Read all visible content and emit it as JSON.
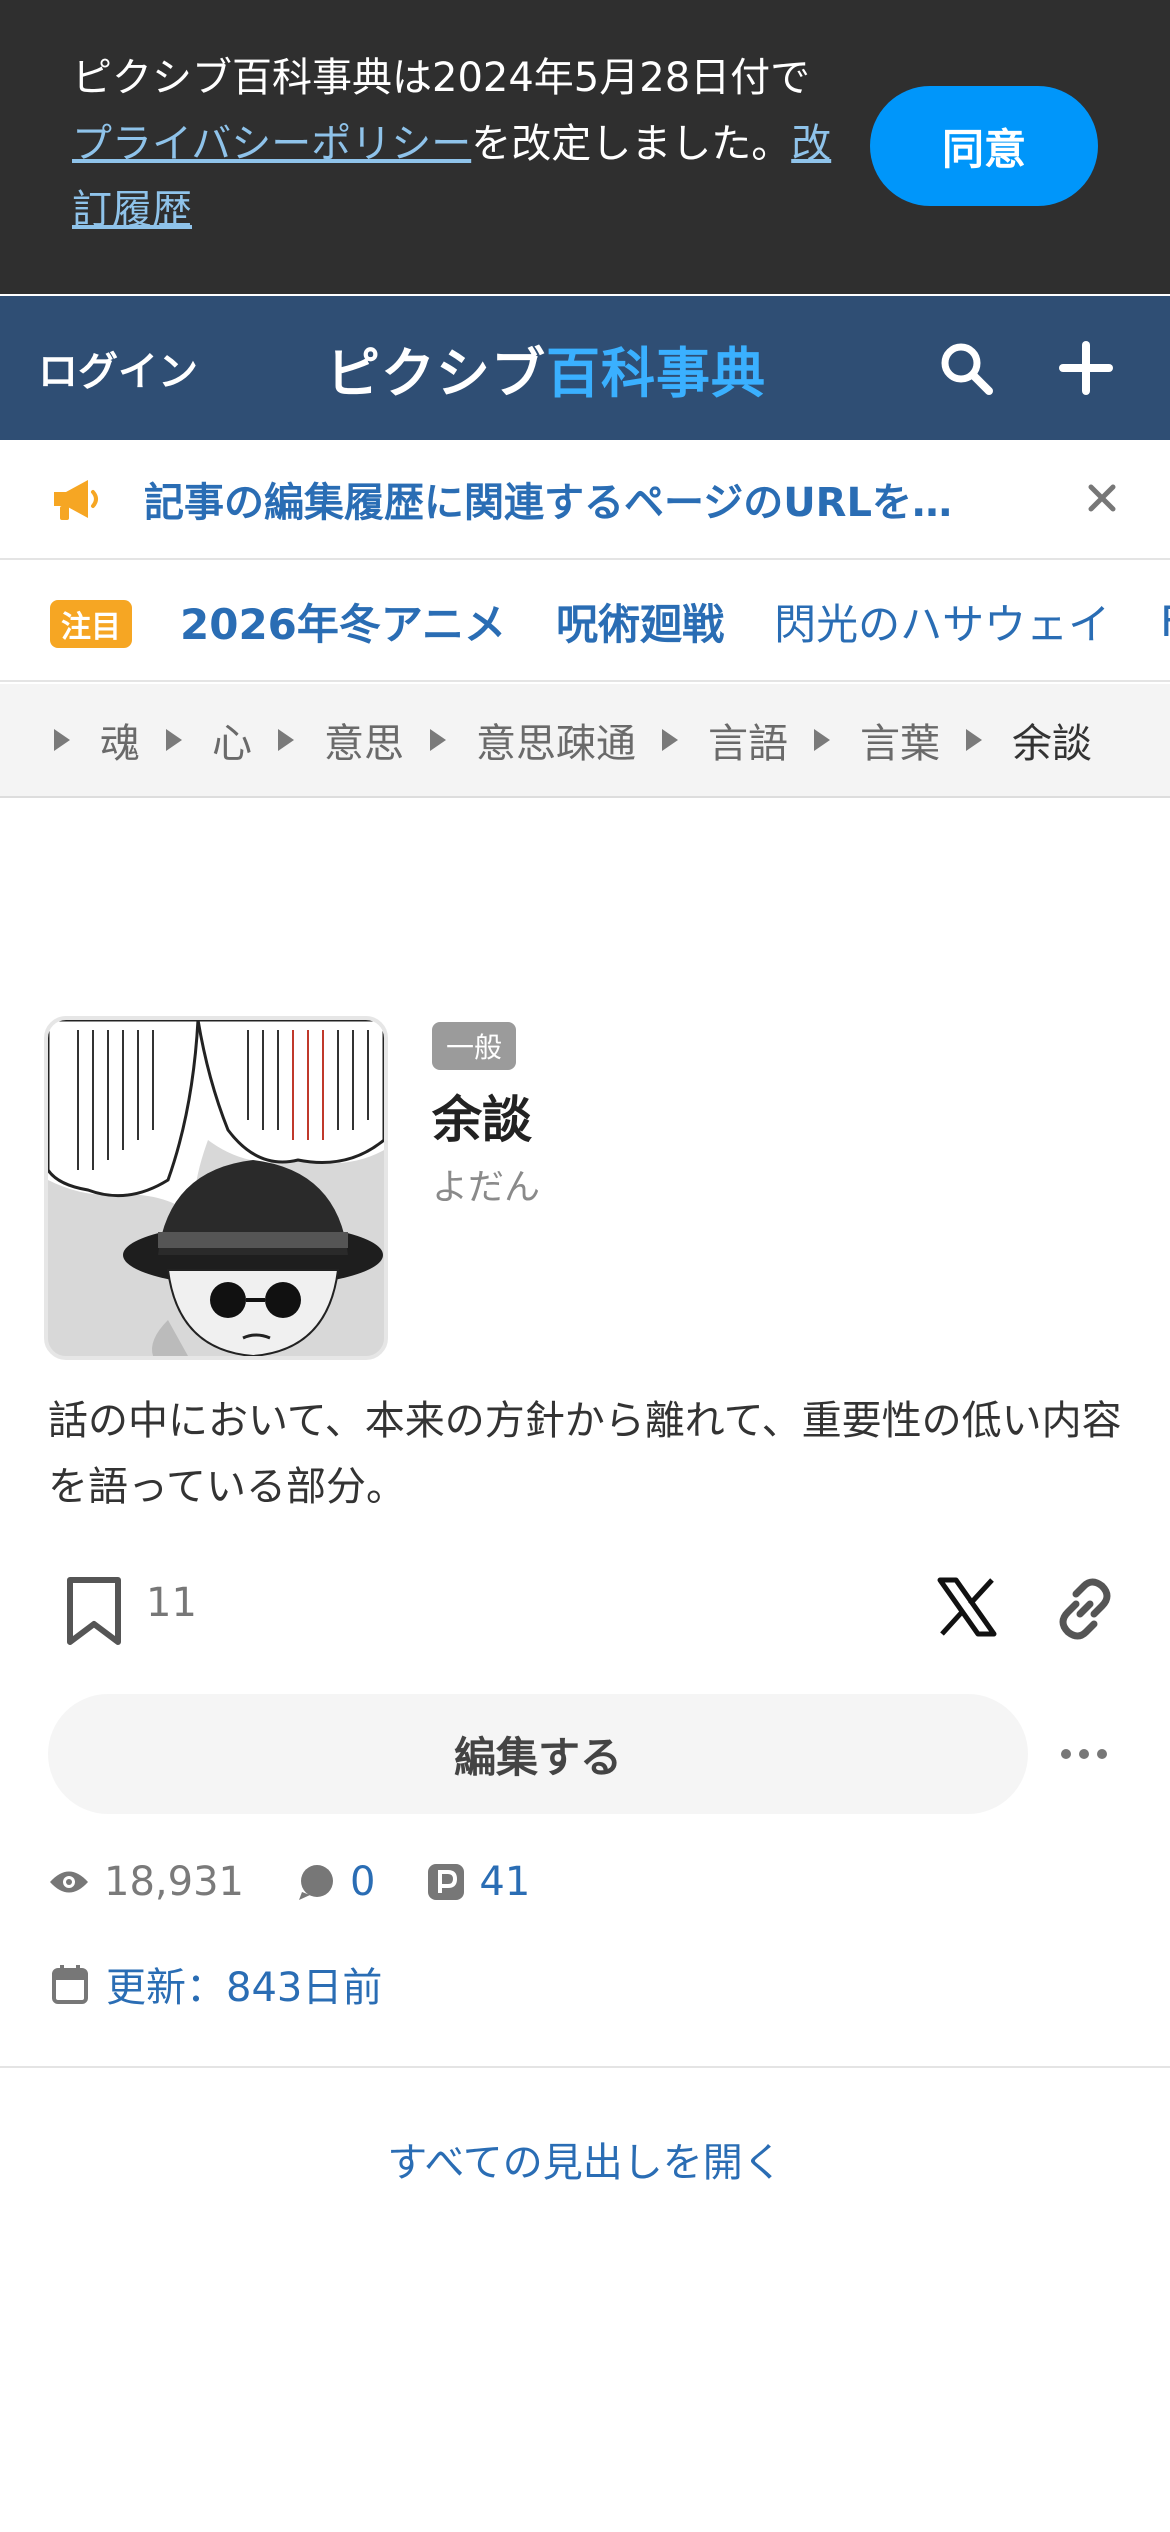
{
  "consent": {
    "text_before": "ピクシブ百科事典は2024年5月28日付で",
    "policy_link": "プライバシーポリシー",
    "text_middle": "を改定しました。",
    "history_link": "改訂履歴",
    "agree_label": "同意"
  },
  "header": {
    "login_label": "ログイン",
    "logo_part1": "ピクシブ",
    "logo_part2": "百科事典",
    "brand_color": "#2f4e74",
    "accent_color": "#3ab0ff"
  },
  "notice": {
    "text": "記事の編集履歴に関連するページのURLを…"
  },
  "trending": {
    "badge": "注目",
    "items": [
      "2026年冬アニメ",
      "呪術廻戦",
      "閃光のハサウェイ",
      "F"
    ]
  },
  "breadcrumb": [
    "魂",
    "心",
    "意思",
    "意思疎通",
    "言語",
    "言葉",
    "余談"
  ],
  "article": {
    "tag": "一般",
    "title": "余談",
    "reading": "よだん",
    "summary": "話の中において、本来の方針から離れて、重要性の低い内容を語っている部分。",
    "bookmark_count": "11",
    "edit_label": "編集する",
    "views": "18,931",
    "comments": "0",
    "pixiv_works": "41",
    "updated": "更新：843日前",
    "open_all_label": "すべての見出しを開く"
  }
}
